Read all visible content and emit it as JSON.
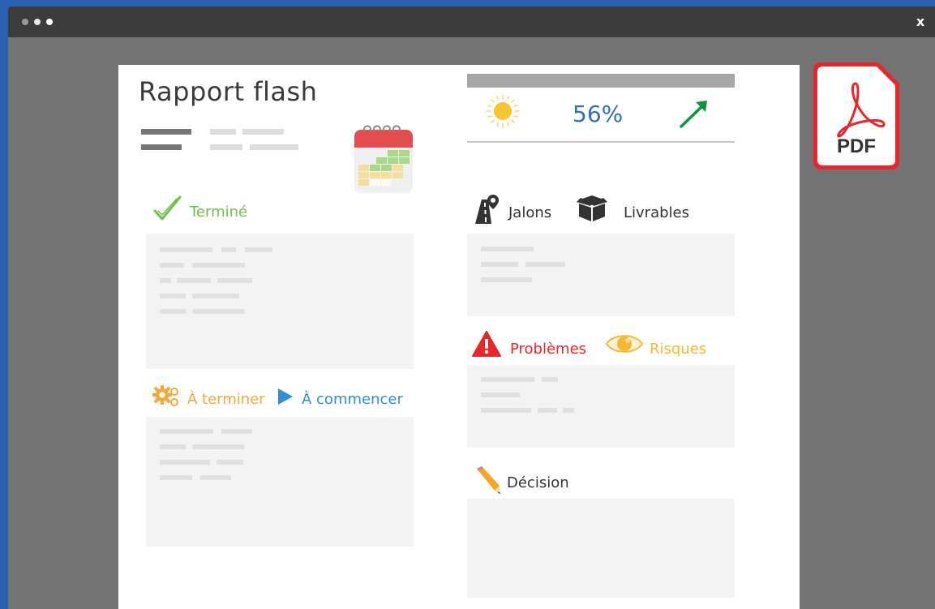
{
  "window": {
    "close_label": "x"
  },
  "report": {
    "title": "Rapport flash",
    "progress_text": "56%",
    "sections": {
      "done": "Terminé",
      "to_finish": "À terminer",
      "to_start": "À commencer",
      "milestones": "Jalons",
      "deliverables": "Livrables",
      "problems": "Problèmes",
      "risks": "Risques",
      "decision": "Décision"
    }
  },
  "pdf": {
    "label": "PDF"
  },
  "colors": {
    "green": "#6cc24a",
    "orange": "#f2a93b",
    "blue": "#2f8fd6",
    "red": "#e8262a",
    "risk_yellow": "#f7b733",
    "progress_blue": "#2f6fb5",
    "arrow_green": "#12923a"
  },
  "icons": {
    "done": "check-icon",
    "to_finish": "gears-icon",
    "to_start": "play-icon",
    "milestones": "road-pin-icon",
    "deliverables": "box-icon",
    "problems": "warning-icon",
    "risks": "eye-icon",
    "decision": "pencil-icon",
    "weather": "sun-icon",
    "trend": "arrow-up-right-icon",
    "calendar": "calendar-icon",
    "pdf": "pdf-icon"
  }
}
